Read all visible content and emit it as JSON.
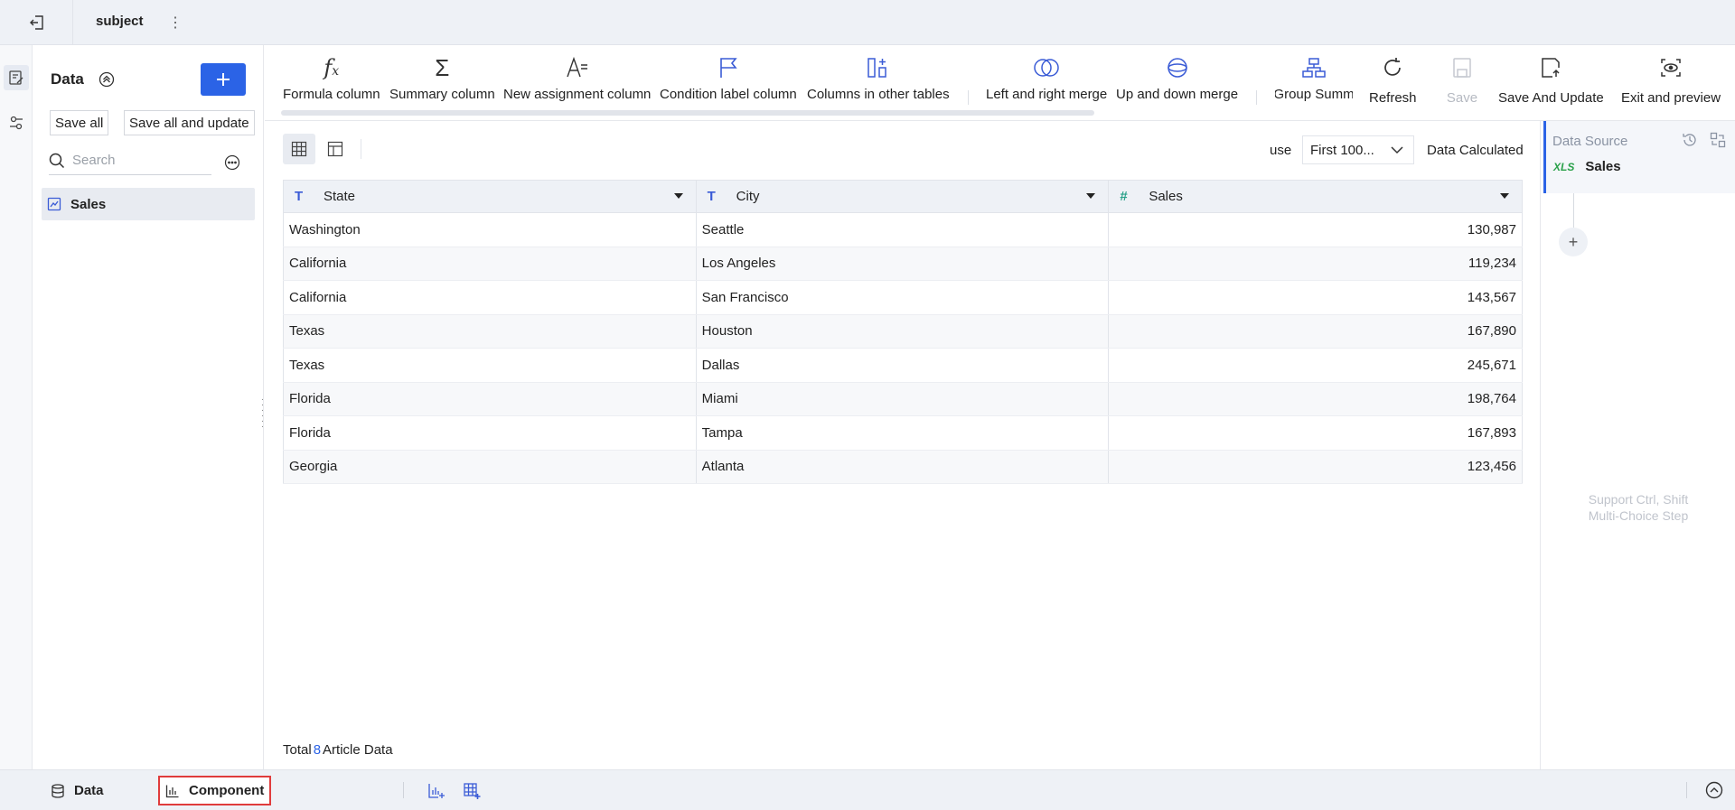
{
  "topbar": {
    "title": "subject"
  },
  "left_panel": {
    "title": "Data",
    "save_all_label": "Save all",
    "save_all_update_label": "Save all and update",
    "search_placeholder": "Search",
    "items": [
      {
        "label": "Sales"
      }
    ]
  },
  "toolbar": {
    "tools": [
      {
        "label": "Formula column",
        "icon": "formula-icon"
      },
      {
        "label": "Summary column",
        "icon": "sigma-icon"
      },
      {
        "label": "New assignment column",
        "icon": "assignment-icon"
      },
      {
        "label": "Condition label column",
        "icon": "flag-icon"
      },
      {
        "label": "Columns in other tables",
        "icon": "columns-add-icon"
      },
      {
        "label": "Left and right merge",
        "icon": "venn-icon"
      },
      {
        "label": "Up and down merge",
        "icon": "stack-merge-icon"
      },
      {
        "label": "Group Summ",
        "icon": "hierarchy-icon"
      },
      {
        "label": "Refresh",
        "icon": "refresh-icon"
      },
      {
        "label": "Save",
        "icon": "save-icon",
        "disabled": true
      },
      {
        "label": "Save And Update",
        "icon": "save-update-icon"
      },
      {
        "label": "Exit and preview",
        "icon": "preview-icon"
      }
    ]
  },
  "main": {
    "use_label": "use",
    "row_limit_value": "First 100...",
    "data_calculated_label": "Data Calculated",
    "columns": [
      {
        "name": "State",
        "type": "text"
      },
      {
        "name": "City",
        "type": "text"
      },
      {
        "name": "Sales",
        "type": "number"
      }
    ],
    "rows": [
      [
        "Washington",
        "Seattle",
        "130,987"
      ],
      [
        "California",
        "Los Angeles",
        "119,234"
      ],
      [
        "California",
        "San Francisco",
        "143,567"
      ],
      [
        "Texas",
        "Houston",
        "167,890"
      ],
      [
        "Texas",
        "Dallas",
        "245,671"
      ],
      [
        "Florida",
        "Miami",
        "198,764"
      ],
      [
        "Florida",
        "Tampa",
        "167,893"
      ],
      [
        "Georgia",
        "Atlanta",
        "123,456"
      ]
    ],
    "footer": {
      "prefix": "Total",
      "count": "8",
      "suffix": "Article Data"
    }
  },
  "right_panel": {
    "title": "Data Source",
    "source_badge": "XLS",
    "source_name": "Sales",
    "hint_line1": "Support Ctrl, Shift",
    "hint_line2": "Multi-Choice Step"
  },
  "bottom_bar": {
    "tabs": [
      {
        "label": "Data",
        "active": false
      },
      {
        "label": "Component",
        "active": true
      }
    ]
  },
  "colors": {
    "accent": "#2b63e6",
    "highlight_border": "#e03c3c",
    "number_type": "#2aa18a"
  }
}
